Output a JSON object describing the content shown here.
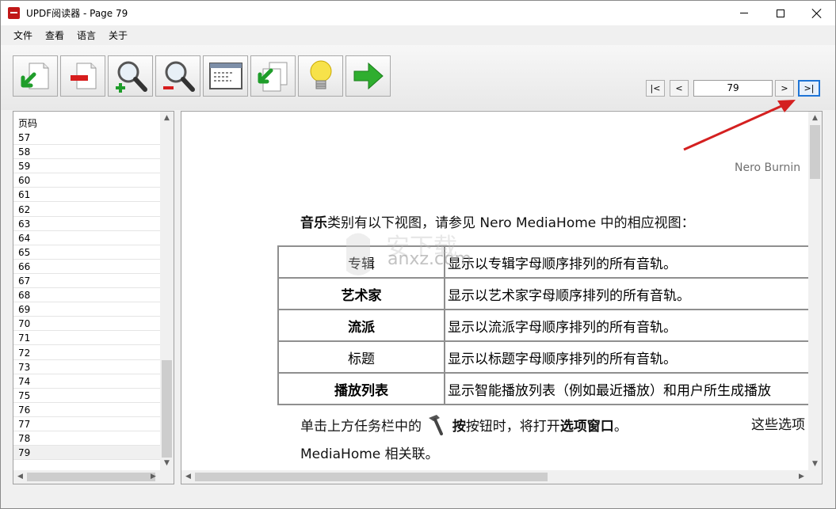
{
  "window": {
    "title": "UPDF阅读器 - Page 79"
  },
  "menu": [
    "文件",
    "查看",
    "语言",
    "关于"
  ],
  "toolbar": {
    "buttons": [
      {
        "name": "open-icon"
      },
      {
        "name": "close-document-icon"
      },
      {
        "name": "zoom-in-icon"
      },
      {
        "name": "zoom-out-icon"
      },
      {
        "name": "fit-window-icon"
      },
      {
        "name": "copy-icon"
      },
      {
        "name": "lightbulb-icon"
      },
      {
        "name": "next-arrow-icon"
      }
    ]
  },
  "pager": {
    "first": "|<",
    "prev": "<",
    "page": "79",
    "next": ">",
    "last": ">|"
  },
  "page_list": {
    "header": "页码",
    "items": [
      "57",
      "58",
      "59",
      "60",
      "61",
      "62",
      "63",
      "64",
      "65",
      "66",
      "67",
      "68",
      "69",
      "70",
      "71",
      "72",
      "73",
      "74",
      "75",
      "76",
      "77",
      "78",
      "79"
    ],
    "selected": "79"
  },
  "document": {
    "header": "Nero Burnin",
    "intro_bold": "音乐",
    "intro_rest": "类别有以下视图，请参见 Nero MediaHome 中的相应视图：",
    "rows": [
      {
        "key": "专辑",
        "value": "显示以专辑字母顺序排列的所有音轨。"
      },
      {
        "key": "艺术家",
        "value": "显示以艺术家字母顺序排列的所有音轨。"
      },
      {
        "key": "流派",
        "value": "显示以流派字母顺序排列的所有音轨。"
      },
      {
        "key": "标题",
        "value": "显示以标题字母顺序排列的所有音轨。"
      },
      {
        "key": "播放列表",
        "value": "显示智能播放列表（例如最近播放）和用户所生成播放"
      }
    ],
    "para_part1": "单击上方任务栏中的",
    "para_part2": "按钮时，将打开",
    "para_bold": "选项窗口",
    "para_part3": "。",
    "para_tail": "这些选项",
    "para_line2": "MediaHome 相关联。",
    "watermark": "anxz.com"
  },
  "colors": {
    "accent": "#1e74d6",
    "annotation_arrow": "#d42020"
  }
}
